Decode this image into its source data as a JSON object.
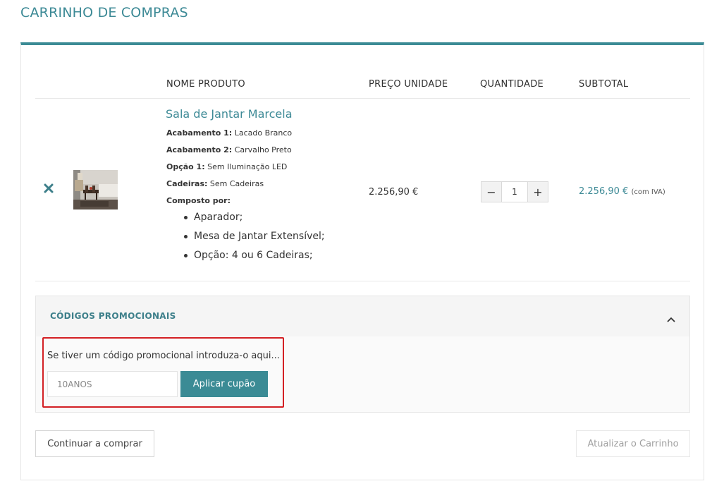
{
  "page": {
    "title": "CARRINHO DE COMPRAS"
  },
  "table": {
    "headers": {
      "name": "NOME PRODUTO",
      "unit_price": "PREÇO UNIDADE",
      "quantity": "QUANTIDADE",
      "subtotal": "SUBTOTAL"
    }
  },
  "item": {
    "name": "Sala de Jantar Marcela",
    "attributes": [
      {
        "label": "Acabamento 1:",
        "value": "Lacado Branco"
      },
      {
        "label": "Acabamento 2:",
        "value": "Carvalho Preto"
      },
      {
        "label": "Opção 1:",
        "value": "Sem Iluminação LED"
      },
      {
        "label": "Cadeiras:",
        "value": "Sem Cadeiras"
      }
    ],
    "composition_label": "Composto por:",
    "composition": [
      "Aparador;",
      "Mesa de Jantar Extensível;",
      "Opção: 4 ou 6 Cadeiras;"
    ],
    "unit_price": "2.256,90 €",
    "quantity": "1",
    "subtotal": "2.256,90 €",
    "vat_note": "(com IVA)",
    "remove_icon": "close-x-icon",
    "minus_symbol": "−",
    "plus_symbol": "+"
  },
  "promo": {
    "title": "CÓDIGOS PROMOCIONAIS",
    "hint": "Se tiver um código promocional introduza-o aqui...",
    "input_value": "10ANOS",
    "apply_label": "Aplicar cupão",
    "toggle_icon": "chevron-up-icon"
  },
  "actions": {
    "continue_label": "Continuar a comprar",
    "update_label": "Atualizar o Carrinho"
  },
  "colors": {
    "accent": "#3b8b95",
    "highlight": "#d32024"
  }
}
